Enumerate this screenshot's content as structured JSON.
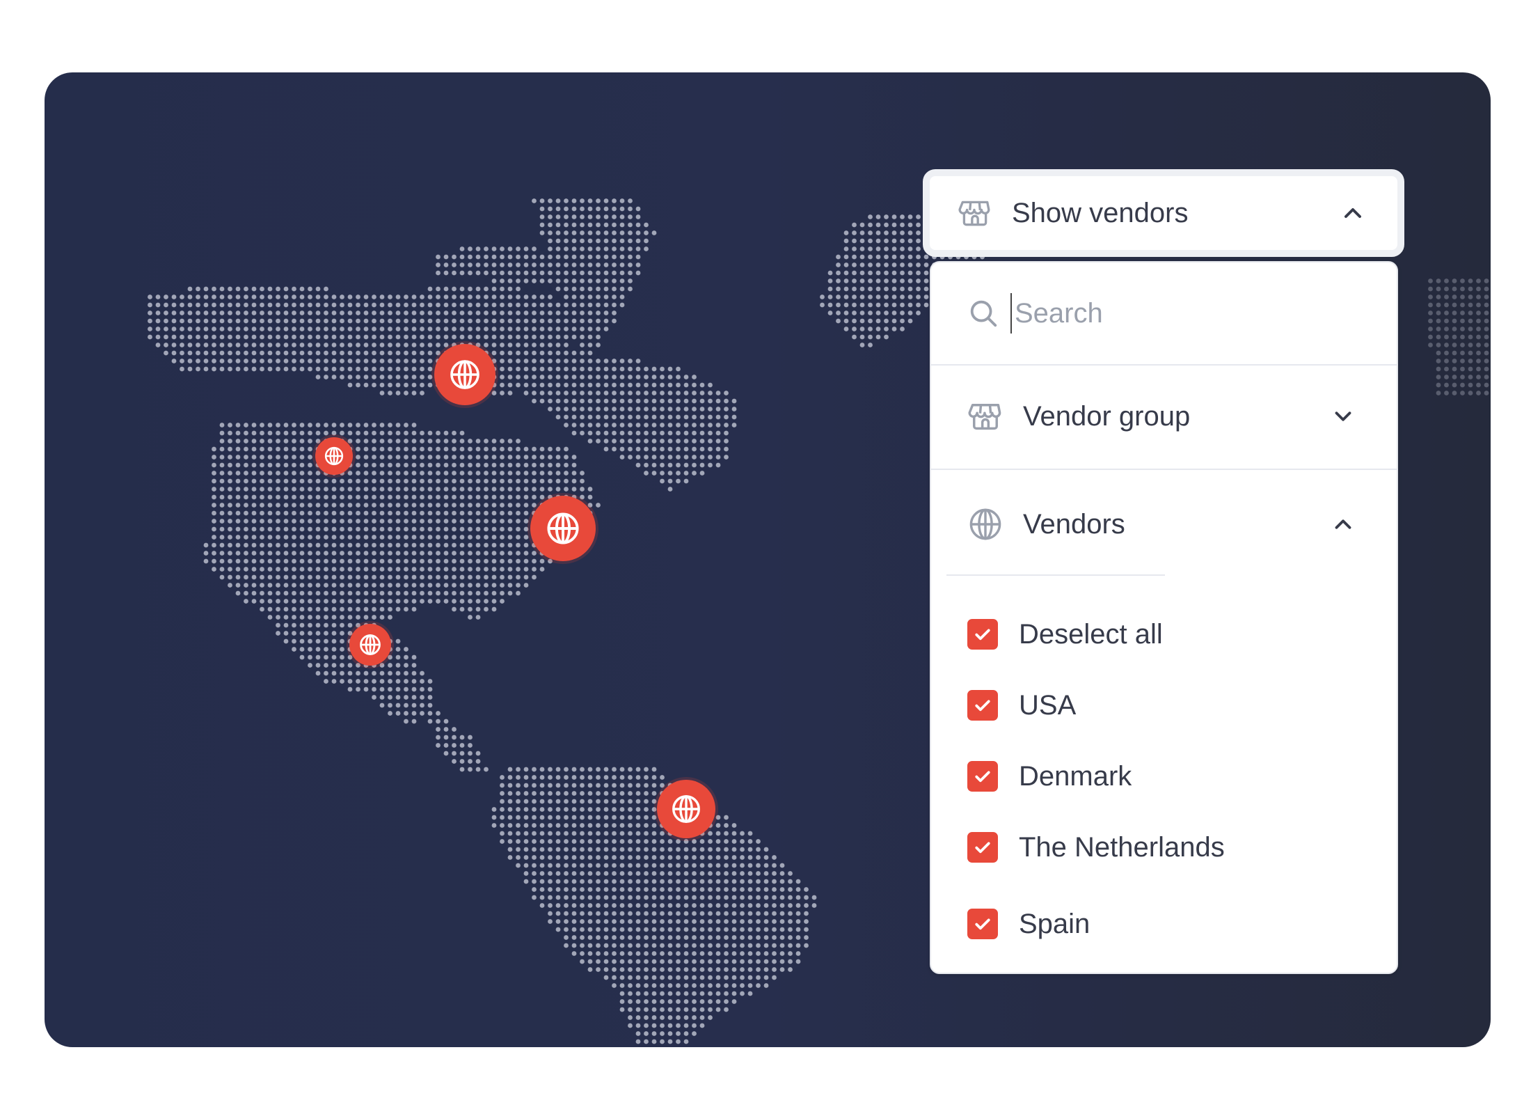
{
  "colors": {
    "accent": "#e8493a",
    "card_background": "#262d4b",
    "map_dots": "#b9bccb",
    "text": "#373b4a",
    "muted": "#9aa0ac"
  },
  "map": {
    "pins": [
      {
        "name": "pin-canada",
        "icon": "globe-icon"
      },
      {
        "name": "pin-west-usa",
        "icon": "globe-icon"
      },
      {
        "name": "pin-east-usa",
        "icon": "globe-icon"
      },
      {
        "name": "pin-mexico",
        "icon": "globe-icon"
      },
      {
        "name": "pin-venezuela",
        "icon": "globe-icon"
      }
    ]
  },
  "header": {
    "label": "Show vendors",
    "icon": "store-icon",
    "state_icon": "chevron-up-icon"
  },
  "panel": {
    "search": {
      "placeholder": "Search",
      "value": "",
      "icon": "search-icon"
    },
    "vendor_group": {
      "label": "Vendor group",
      "icon": "store-icon",
      "state_icon": "chevron-down-icon"
    },
    "vendors": {
      "label": "Vendors",
      "icon": "globe-icon",
      "state_icon": "chevron-up-icon"
    },
    "options": [
      {
        "label": "Deselect all",
        "checked": true
      },
      {
        "label": "USA",
        "checked": true
      },
      {
        "label": "Denmark",
        "checked": true
      },
      {
        "label": "The Netherlands",
        "checked": true
      },
      {
        "label": "Spain",
        "checked": true
      }
    ]
  }
}
